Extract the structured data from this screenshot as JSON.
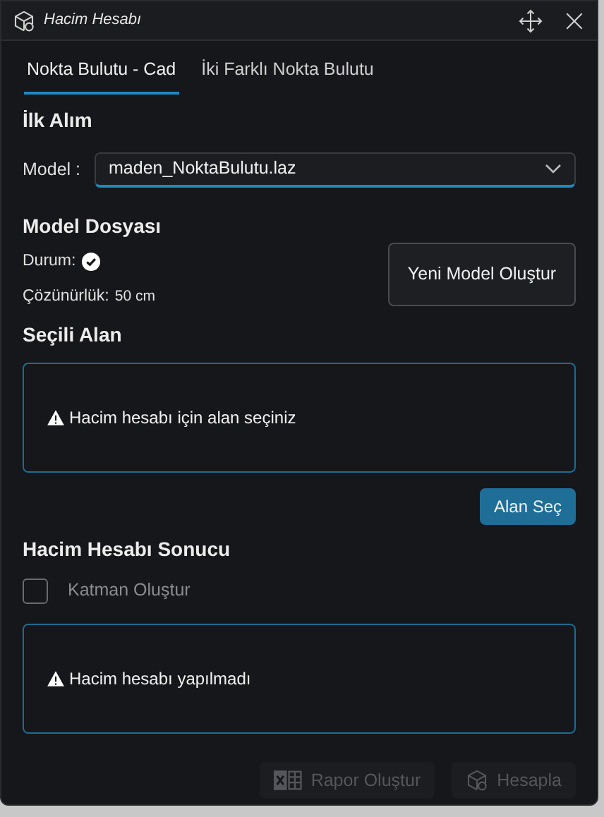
{
  "window": {
    "title": "Hacim Hesabı"
  },
  "tabs": [
    {
      "label": "Nokta Bulutu - Cad",
      "selected": true
    },
    {
      "label": "İki Farklı Nokta Bulutu",
      "selected": false
    }
  ],
  "first_survey": {
    "heading": "İlk Alım",
    "model_label": "Model :",
    "model_value": "maden_NoktaBulutu.laz"
  },
  "model_file": {
    "heading": "Model Dosyası",
    "status_label": "Durum:",
    "resolution_label": "Çözünürlük:",
    "resolution_value": "50 cm",
    "button": "Yeni Model Oluştur"
  },
  "selected_area": {
    "heading": "Seçili Alan",
    "message": "Hacim hesabı için alan seçiniz",
    "button": "Alan Seç"
  },
  "result": {
    "heading": "Hacim Hesabı Sonucu",
    "layer_checkbox": {
      "label": "Katman Oluştur",
      "checked": false
    },
    "message": "Hacim hesabı yapılmadı"
  },
  "footer_buttons": [
    {
      "kind": "excel",
      "label": "Rapor Oluştur",
      "disabled": true
    },
    {
      "kind": "cube",
      "label": "Hesapla",
      "disabled": true
    }
  ]
}
